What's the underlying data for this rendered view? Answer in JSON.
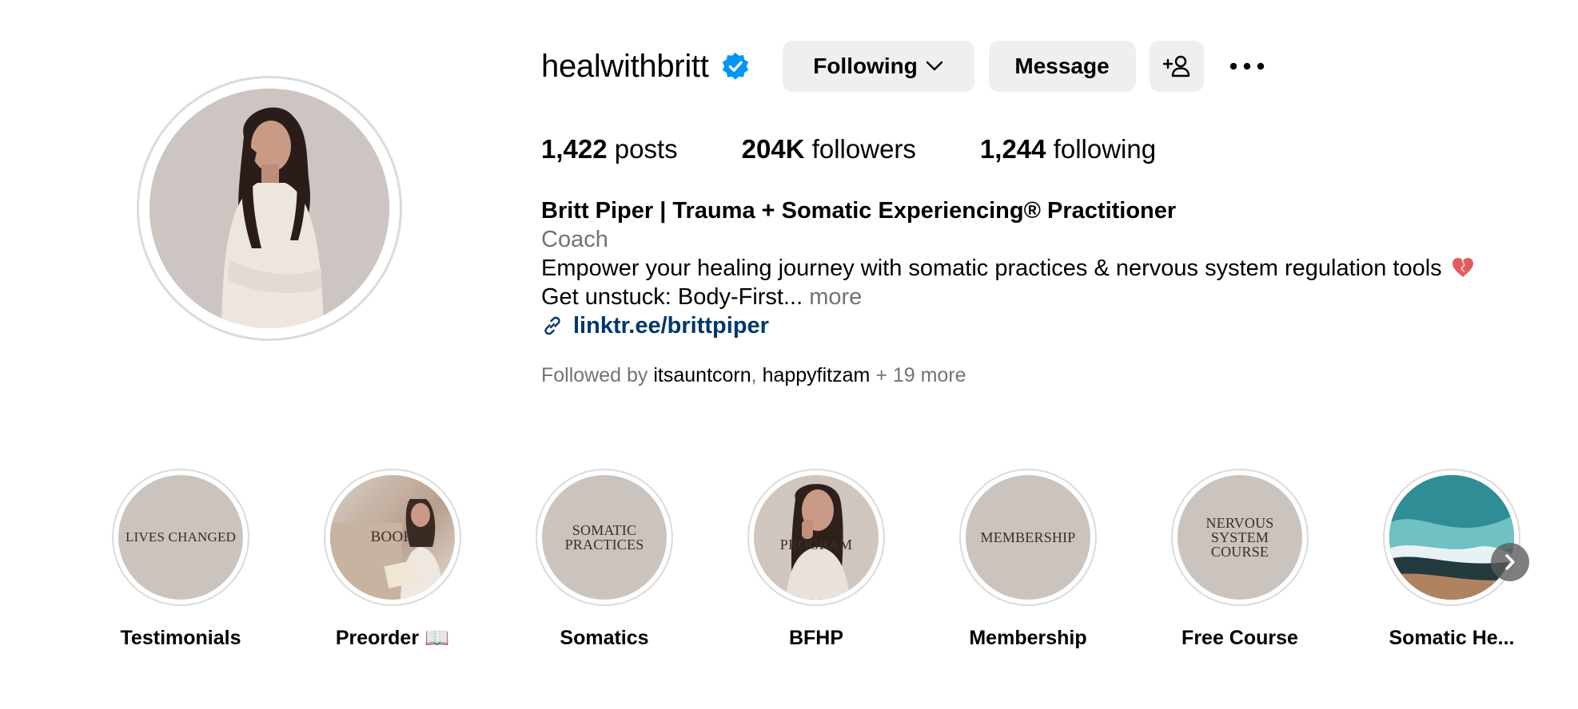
{
  "profile": {
    "username": "healwithbritt",
    "verified_icon": "verified-badge-icon",
    "buttons": {
      "following": "Following",
      "message": "Message"
    },
    "stats": {
      "posts_count": "1,422",
      "posts_label": "posts",
      "followers_count": "204K",
      "followers_label": "followers",
      "following_count": "1,244",
      "following_label": "following"
    },
    "bio": {
      "name": "Britt Piper | Trauma + Somatic Experiencing® Practitioner",
      "category": "Coach",
      "line1": "Empower your healing journey with somatic practices & nervous system regulation tools",
      "line2": "Get unstuck: Body-First...",
      "more": "more",
      "link": "linktr.ee/brittpiper"
    },
    "followed_by": {
      "prefix": "Followed by",
      "account1": "itsauntcorn",
      "separator": ",",
      "account2": "happyfitzam",
      "suffix": "+ 19 more"
    }
  },
  "highlights": [
    {
      "cover_text": "LIVES CHANGED",
      "label": "Testimonials"
    },
    {
      "cover_text": "BOOK",
      "label": "Preorder 📖"
    },
    {
      "cover_text": "SOMATIC PRACTICES",
      "label": "Somatics"
    },
    {
      "cover_text": "PROGRAM",
      "label": "BFHP"
    },
    {
      "cover_text": "MEMBERSHIP",
      "label": "Membership"
    },
    {
      "cover_text": "NERVOUS SYSTEM COURSE",
      "label": "Free Course"
    },
    {
      "cover_text": "",
      "label": "Somatic He..."
    }
  ],
  "colors": {
    "button_bg": "#efefef",
    "secondary_text": "#737373",
    "link": "#00376b",
    "verified": "#0095f6",
    "highlight_bg": "#cbc3bd"
  }
}
